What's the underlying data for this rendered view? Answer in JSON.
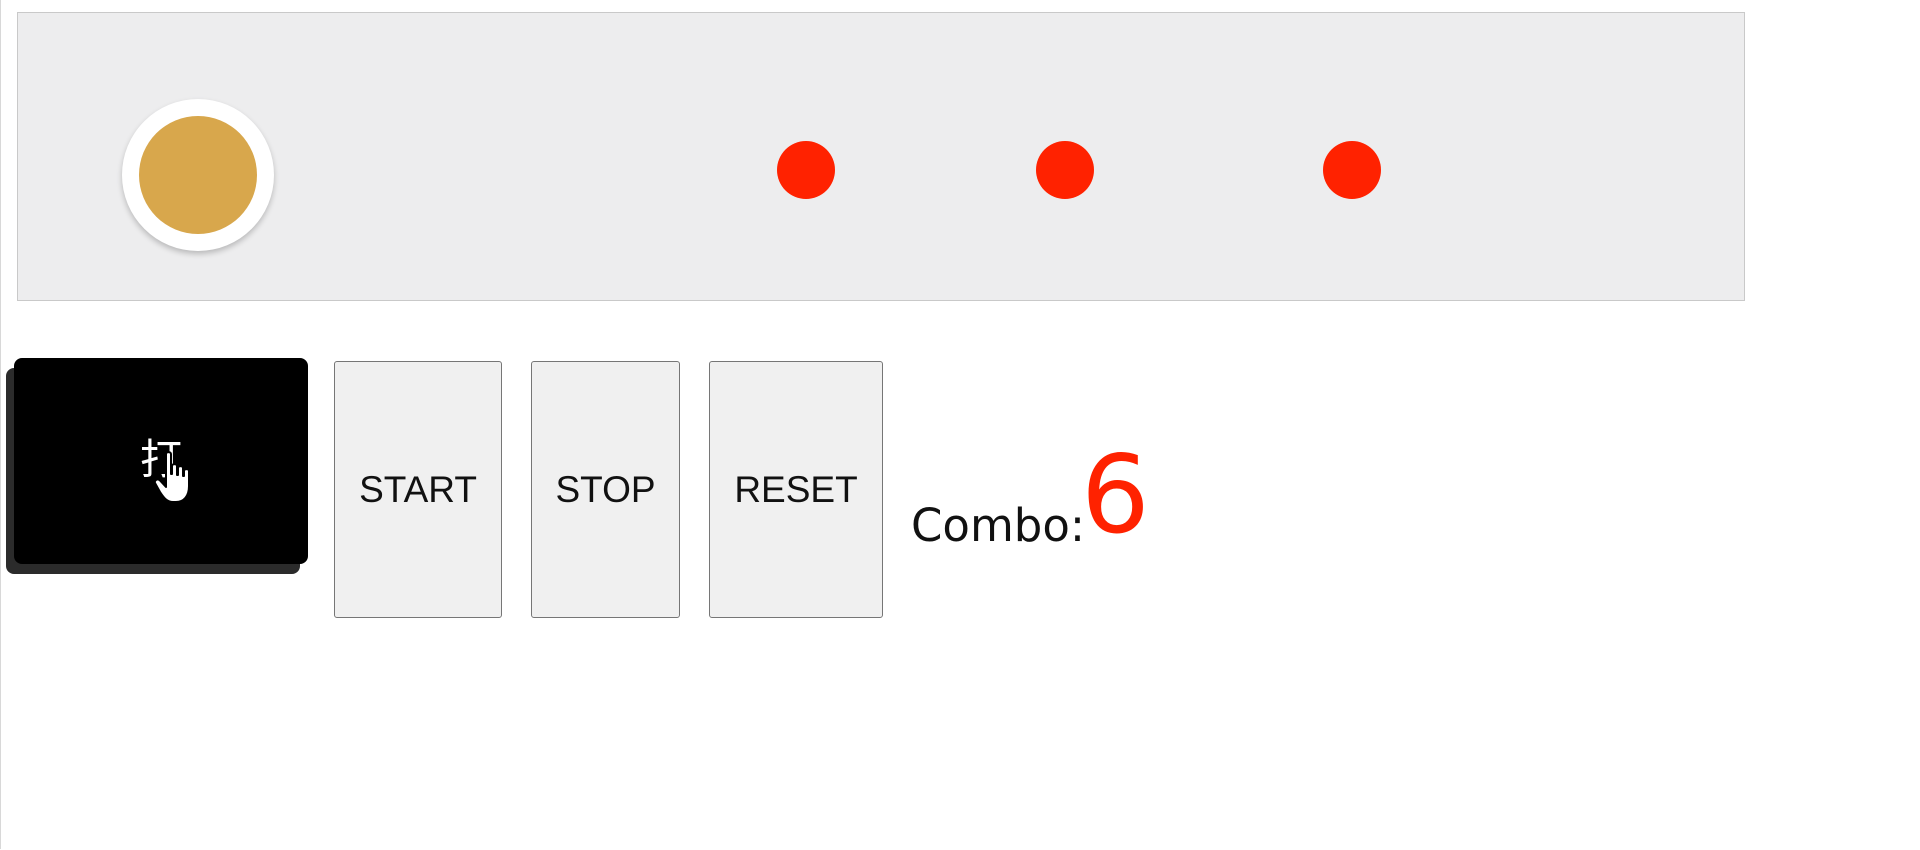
{
  "game": {
    "track": {
      "judge_circle_color": "#d8a74c",
      "note_color": "#ff2200",
      "notes": [
        {
          "id": 1
        },
        {
          "id": 2
        },
        {
          "id": 3
        }
      ]
    },
    "controls": {
      "hit_label": "打",
      "start_label": "START",
      "stop_label": "STOP",
      "reset_label": "RESET"
    },
    "combo": {
      "label": "Combo:",
      "value": "6",
      "value_color": "#ff2200"
    },
    "icons": {
      "cursor": "hand-pointer-icon"
    }
  }
}
